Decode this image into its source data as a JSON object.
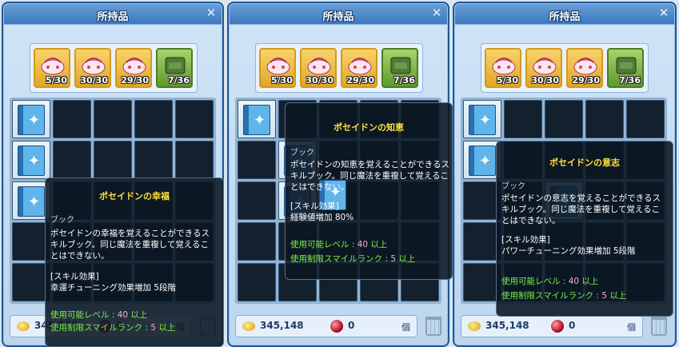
{
  "panels": [
    {
      "title": "所持品",
      "slots": [
        {
          "count": "5/30",
          "color": "gold"
        },
        {
          "count": "30/30",
          "color": "gold"
        },
        {
          "count": "29/30",
          "color": "gold"
        },
        {
          "count": "7/36",
          "color": "green"
        }
      ],
      "money": "345,148",
      "gems": "0",
      "unit": "個"
    },
    {
      "title": "所持品",
      "slots": [
        {
          "count": "5/30",
          "color": "gold"
        },
        {
          "count": "30/30",
          "color": "gold"
        },
        {
          "count": "29/30",
          "color": "gold"
        },
        {
          "count": "7/36",
          "color": "green"
        }
      ],
      "money": "345,148",
      "gems": "0",
      "unit": "個"
    },
    {
      "title": "所持品",
      "slots": [
        {
          "count": "5/30",
          "color": "gold"
        },
        {
          "count": "30/30",
          "color": "gold"
        },
        {
          "count": "29/30",
          "color": "gold"
        },
        {
          "count": "7/36",
          "color": "green"
        }
      ],
      "money": "345,148",
      "gems": "0",
      "unit": "個"
    }
  ],
  "tooltips": [
    {
      "title": "ポセイドンの幸福",
      "category": "ブック",
      "desc": "ポセイドンの幸福を覚えることができるス\nキルブック。同じ魔法を重複して覚えるこ\nとはできない。",
      "effect_header": "[スキル効果]",
      "effect": "幸運チューニング効果増加 5段階",
      "level_label": "使用可能レベル : ",
      "level_value": "40",
      "level_suffix": " 以上",
      "rank_label": "使用制限スマイルランク : ",
      "rank_value": "5",
      "rank_suffix": " 以上"
    },
    {
      "title": "ポセイドンの知恵",
      "category": "ブック",
      "desc": "ポセイドンの知恵を覚えることができるス\nキルブック。同じ魔法を重複して覚えるこ\nとはできない。",
      "effect_header": "[スキル効果]",
      "effect": "経験値増加 80%",
      "level_label": "使用可能レベル : ",
      "level_value": "40",
      "level_suffix": " 以上",
      "rank_label": "使用制限スマイルランク : ",
      "rank_value": "5",
      "rank_suffix": " 以上"
    },
    {
      "title": "ポセイドンの意志",
      "category": "ブック",
      "desc": "ポセイドンの意志を覚えることができるス\nキルブック。同じ魔法を重複して覚えるこ\nとはできない。",
      "effect_header": "[スキル効果]",
      "effect": "パワーチューニング効果増加 5段階",
      "level_label": "使用可能レベル : ",
      "level_value": "40",
      "level_suffix": " 以上",
      "rank_label": "使用制限スマイルランク : ",
      "rank_value": "5",
      "rank_suffix": " 以上"
    }
  ]
}
